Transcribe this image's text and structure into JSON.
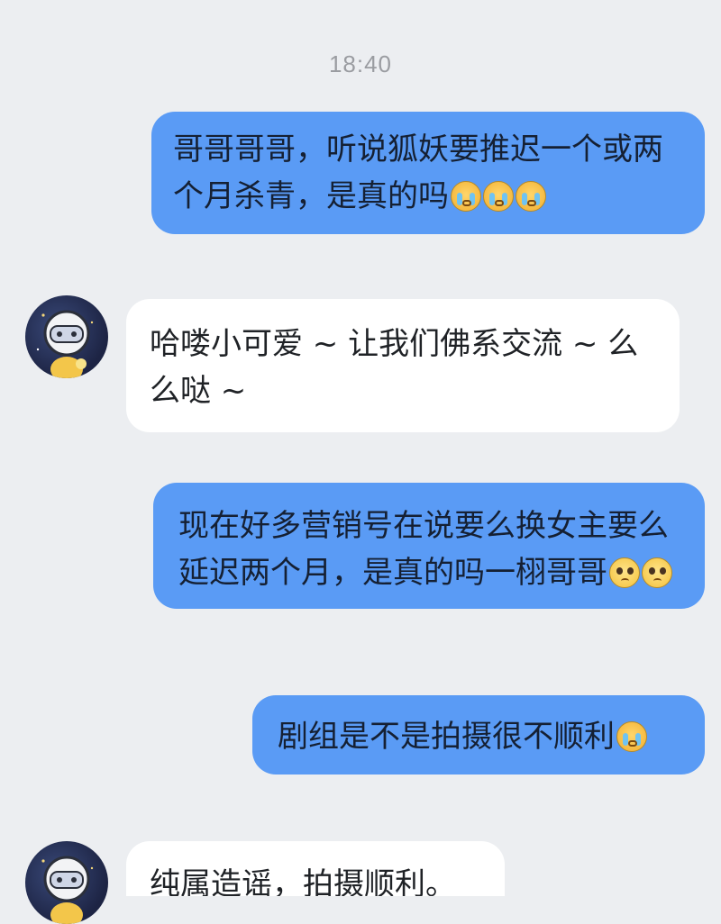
{
  "chat": {
    "timestamp": "18:40",
    "messages": [
      {
        "sender": "me",
        "text": "哥哥哥哥，听说狐妖要推迟一个或两个月杀青，是真的吗",
        "emojis": [
          "cry-icon",
          "cry-icon",
          "cry-icon"
        ]
      },
      {
        "sender": "other",
        "text": "哈喽小可爱 ~ 让我们佛系交流 ~ 么么哒 ~",
        "emojis": []
      },
      {
        "sender": "me",
        "text": "现在好多营销号在说要么换女主要么延迟两个月，是真的吗一栩哥哥",
        "emojis": [
          "pleading-face-icon",
          "pleading-face-icon"
        ]
      },
      {
        "sender": "me",
        "text": "剧组是不是拍摄很不顺利",
        "emojis": [
          "cry-icon"
        ]
      },
      {
        "sender": "other",
        "text": "纯属造谣，拍摄顺利。",
        "emojis": []
      }
    ]
  },
  "colors": {
    "background": "#eceef1",
    "outgoing_bubble": "#5a9bf5",
    "incoming_bubble": "#ffffff",
    "timestamp": "#9a9ca1"
  }
}
